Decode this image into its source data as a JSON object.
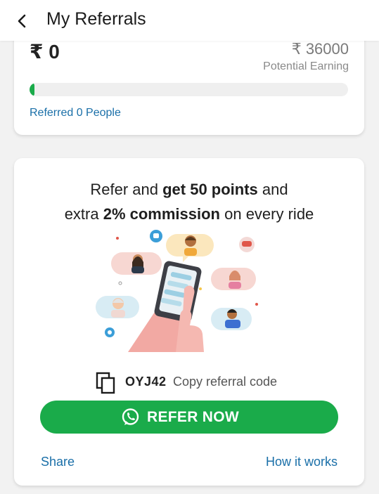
{
  "header": {
    "title": "My Referrals"
  },
  "summary": {
    "earned": "₹ 0",
    "potential_amount": "₹ 36000",
    "potential_label": "Potential Earning",
    "progress_fraction": 0.015,
    "referred_text": "Referred 0 People"
  },
  "offer": {
    "line1_pre": "Refer and ",
    "line1_bold": "get 50 points",
    "line1_post": " and",
    "line2_pre": "extra ",
    "line2_bold": "2% commission",
    "line2_post": " on every ride"
  },
  "referral": {
    "code": "OYJ42",
    "copy_label": "Copy referral code"
  },
  "actions": {
    "refer_now": "REFER NOW",
    "share": "Share",
    "how_it_works": "How it works"
  },
  "colors": {
    "accent_green": "#1aab4a",
    "link_blue": "#1a6fa8"
  },
  "icons": [
    "back-arrow-icon",
    "copy-icon",
    "whatsapp-icon"
  ]
}
